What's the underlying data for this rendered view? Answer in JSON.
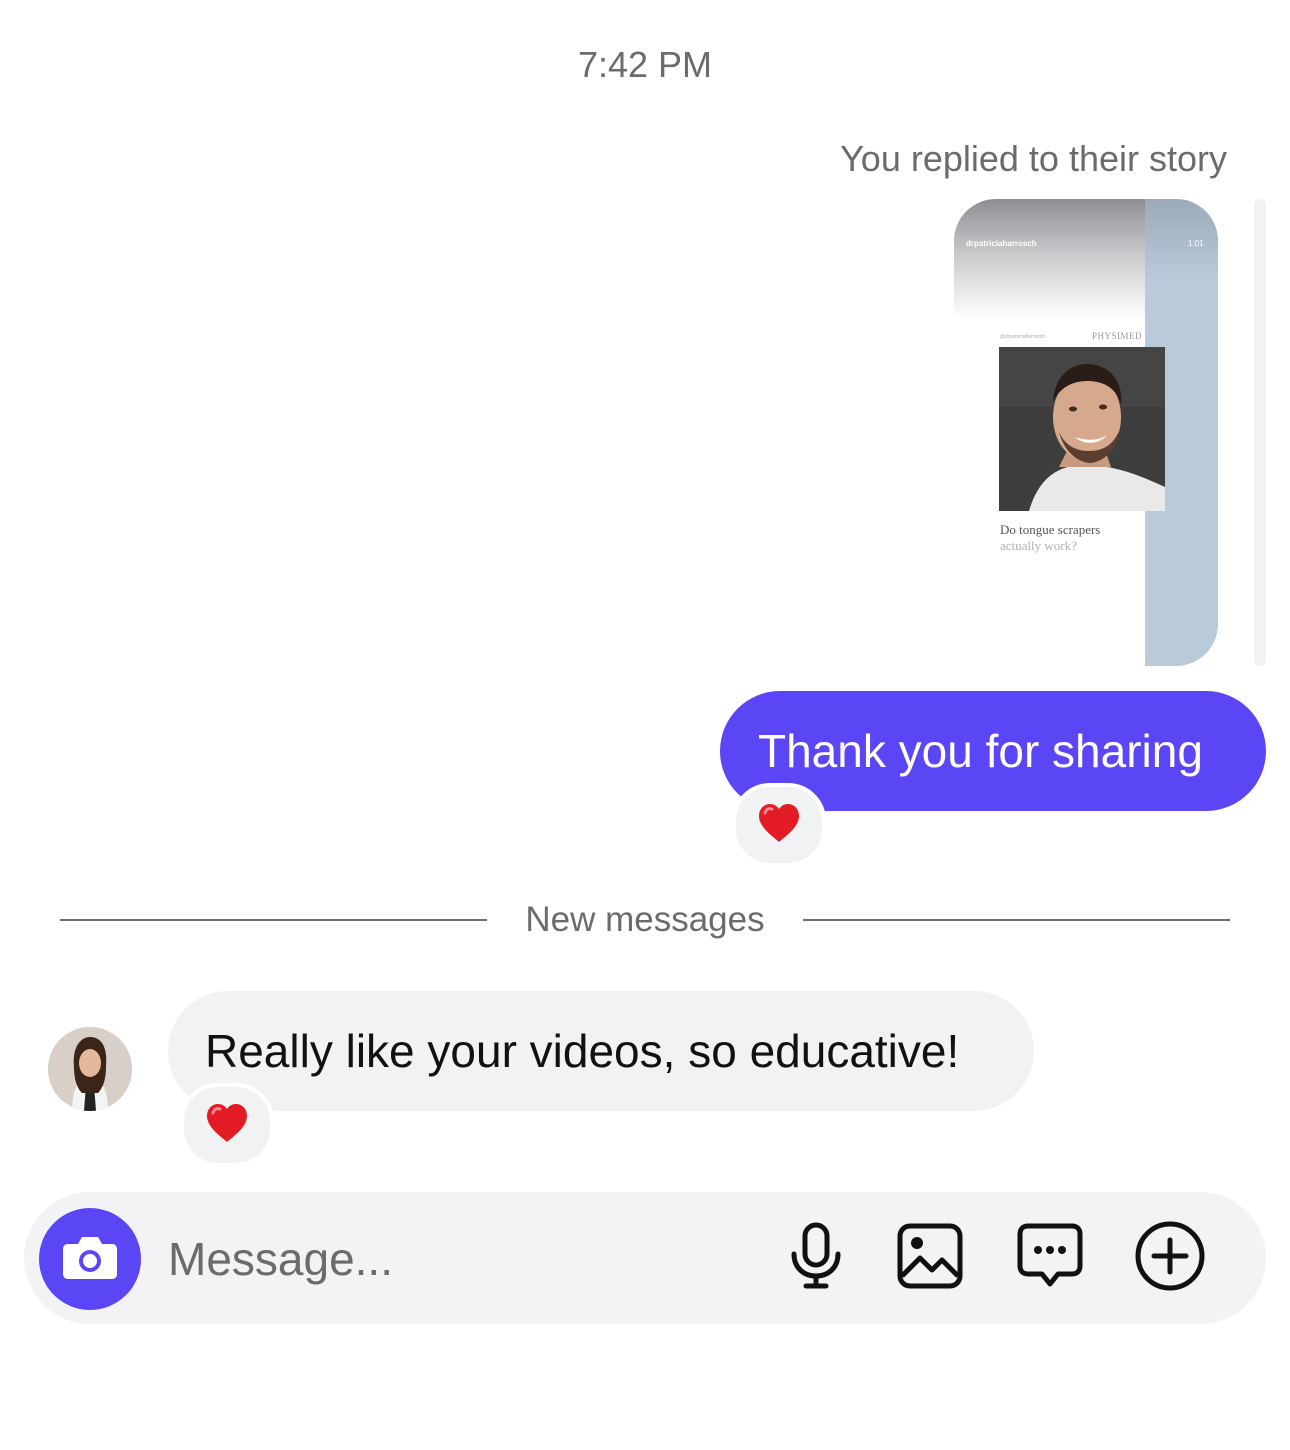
{
  "conversation": {
    "timestamp": "7:42 PM",
    "story_reply_label": "You replied to their story",
    "story": {
      "username": "drpatriciaharrosch",
      "time": "1:01",
      "brand": "PHYSIMED",
      "question_line1": "Do tongue scrapers",
      "question_line2": "actually work?"
    },
    "outgoing_message": "Thank you for sharing",
    "outgoing_reaction": "❤️",
    "divider_label": "New messages",
    "incoming_message": "Really like your videos, so educative!",
    "incoming_reaction": "❤️"
  },
  "composer": {
    "placeholder": "Message...",
    "icons": [
      "camera-icon",
      "microphone-icon",
      "gallery-icon",
      "chat-bubble-icon",
      "plus-circle-icon"
    ]
  },
  "colors": {
    "accent": "#5b46f5",
    "bubble_gray": "#f1f2f4",
    "muted_text": "#6b6b6b"
  }
}
